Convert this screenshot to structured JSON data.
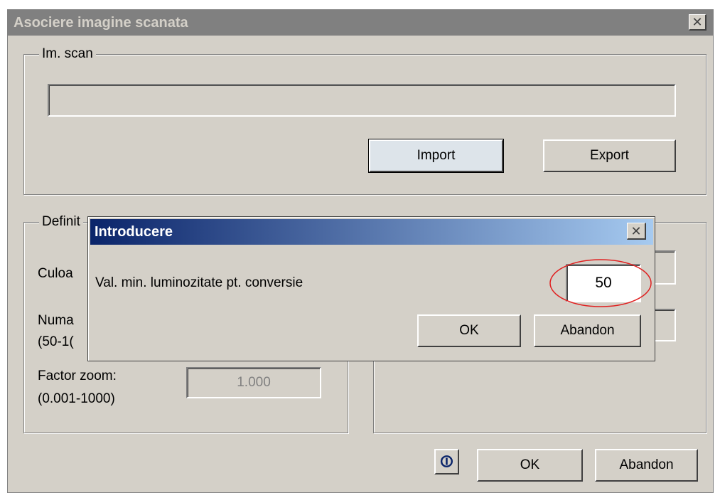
{
  "main_window": {
    "title": "Asociere imagine scanata",
    "close_glyph": "✕",
    "scan_group": {
      "legend": "Im. scan",
      "import_label": "Import",
      "export_label": "Export"
    },
    "def_group": {
      "legend_visible": "Definit",
      "color_label_visible": "Culoa",
      "number_label_visible": "Numa",
      "number_range_visible": "(50-1(",
      "zoom_label": "Factor zoom:",
      "zoom_range": "(0.001-1000)",
      "zoom_value": "1.000"
    },
    "info_icon_glyph": "⏼",
    "ok_label": "OK",
    "cancel_label": "Abandon"
  },
  "dialog": {
    "title": "Introducere",
    "close_glyph": "✕",
    "prompt": "Val. min. luminozitate pt. conversie",
    "value": "50",
    "ok_label": "OK",
    "cancel_label": "Abandon",
    "highlight_color": "#e02020"
  }
}
